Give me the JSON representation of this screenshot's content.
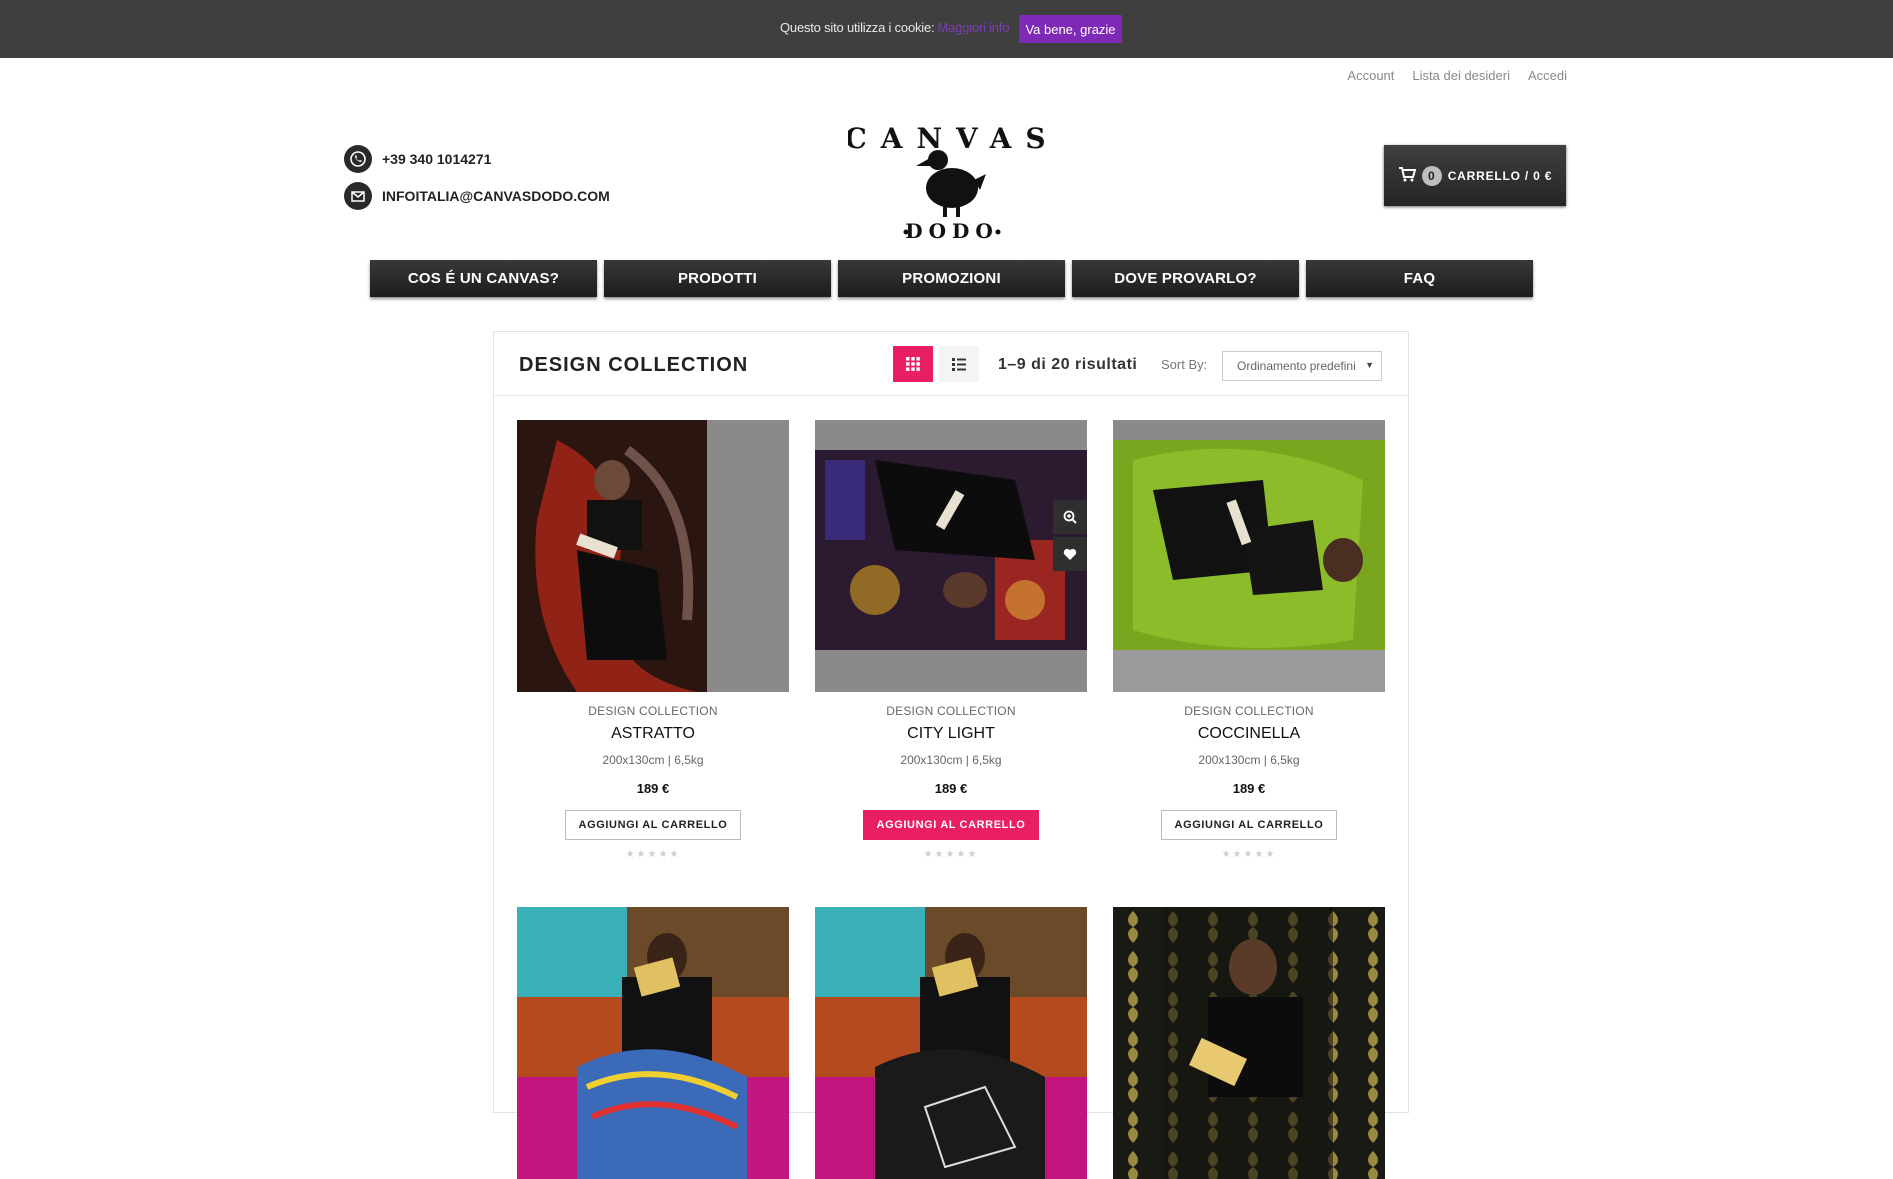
{
  "cookie_bar": {
    "text": "Questo sito utilizza i cookie:",
    "link": "Maggiori info",
    "button": "Va bene, grazie"
  },
  "top_links": [
    "Account",
    "Lista dei desideri",
    "Accedi"
  ],
  "contacts": {
    "phone": "+39 340 1014271",
    "email": "INFOITALIA@CANVASDODO.COM"
  },
  "logo": {
    "line1": "CANVAS",
    "line2": "DODO"
  },
  "cart": {
    "count": "0",
    "label": "CARRELLO / 0 €"
  },
  "nav": [
    "COS É UN CANVAS?",
    "PRODOTTI",
    "PROMOZIONI",
    "DOVE PROVARLO?",
    "FAQ"
  ],
  "listing": {
    "title": "DESIGN COLLECTION",
    "result_count": "1–9 di 20 risultati",
    "sort_label": "Sort By:",
    "sort_value": "Ordinamento predefinito"
  },
  "products": [
    {
      "category": "DESIGN COLLECTION",
      "name": "ASTRATTO",
      "size": "200x130cm | 6,5kg",
      "price": "189 €",
      "button": "AGGIUNGI AL CARRELLO",
      "accent": "#b02a1e"
    },
    {
      "category": "DESIGN COLLECTION",
      "name": "CITY LIGHT",
      "size": "200x130cm | 6,5kg",
      "price": "189 €",
      "button": "AGGIUNGI AL CARRELLO",
      "accent": "#6a2a5a"
    },
    {
      "category": "DESIGN COLLECTION",
      "name": "COCCINELLA",
      "size": "200x130cm | 6,5kg",
      "price": "189 €",
      "button": "AGGIUNGI AL CARRELLO",
      "accent": "#7aa61f"
    }
  ],
  "colors": {
    "accent": "#e91e63",
    "cookie_button": "#7f2ab6",
    "dark": "#2a2a2a"
  }
}
